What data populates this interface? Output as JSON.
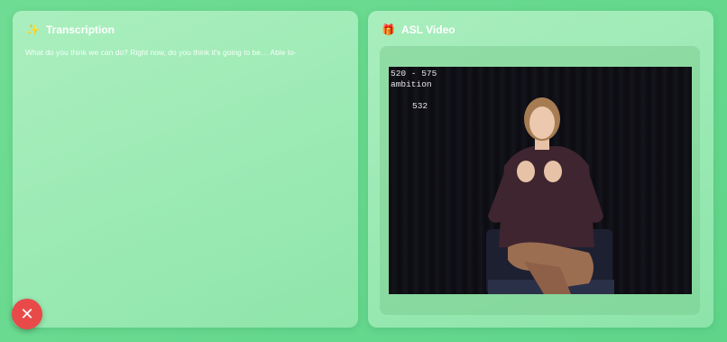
{
  "transcription": {
    "icon": "sparkles-icon",
    "title": "Transcription",
    "text": "What do you think we can do? Right now, do you think it's going to be… Able to-"
  },
  "asl_video": {
    "icon": "gift-icon",
    "title": "ASL Video",
    "overlay": {
      "range": "520 - 575",
      "gloss": "ambition",
      "frame": "532"
    }
  },
  "close_button": {
    "icon": "close-icon",
    "label": "✕"
  },
  "colors": {
    "background": "#5fd58a",
    "close_button": "#e84a4a"
  }
}
